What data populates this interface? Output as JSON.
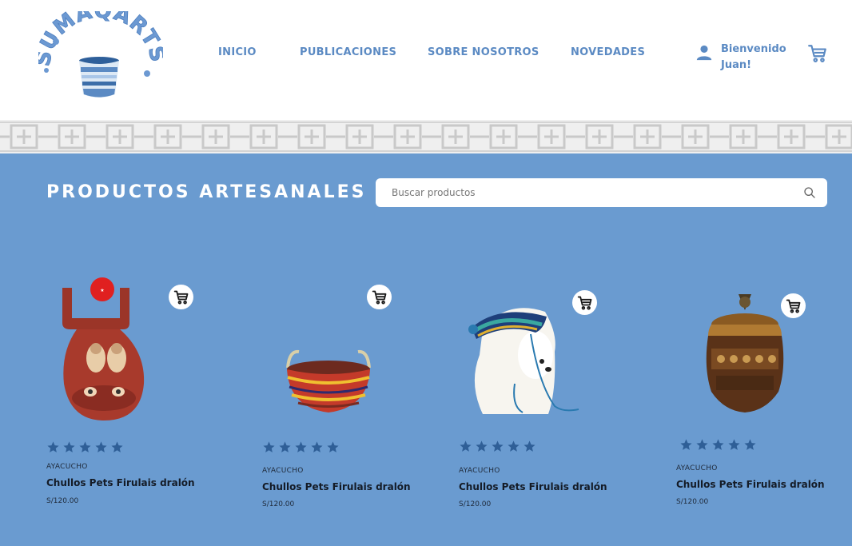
{
  "brand": {
    "name": "SUMAQARTS"
  },
  "nav": {
    "items": [
      {
        "label": "INICIO"
      },
      {
        "label": "PUBLICACIONES"
      },
      {
        "label": "SOBRE NOSOTROS"
      },
      {
        "label": "NOVEDADES"
      }
    ]
  },
  "user": {
    "greeting": "Bienvenido Juan!"
  },
  "main": {
    "title": "PRODUCTOS ARTESANALES",
    "search": {
      "placeholder": "Buscar productos",
      "value": ""
    }
  },
  "products": [
    {
      "region": "AYACUCHO",
      "name": "Chullos Pets Firulais dralón",
      "price": "S/120.00",
      "rating": 5,
      "image": "ceramic-church-vessel"
    },
    {
      "region": "AYACUCHO",
      "name": "Chullos Pets Firulais dralón",
      "price": "S/120.00",
      "rating": 5,
      "image": "woven-basket"
    },
    {
      "region": "AYACUCHO",
      "name": "Chullos Pets Firulais dralón",
      "price": "S/120.00",
      "rating": 5,
      "image": "dog-with-chullo-hat"
    },
    {
      "region": "AYACUCHO",
      "name": "Chullos Pets Firulais dralón",
      "price": "S/120.00",
      "rating": 5,
      "image": "decorated-jar"
    }
  ],
  "colors": {
    "background": "#6a9bd0",
    "nav_text": "#5b8ac3",
    "star": "#2f5f97"
  },
  "icons": [
    "user-icon",
    "cart-icon",
    "search-icon",
    "star-icon",
    "add-to-cart-icon"
  ]
}
